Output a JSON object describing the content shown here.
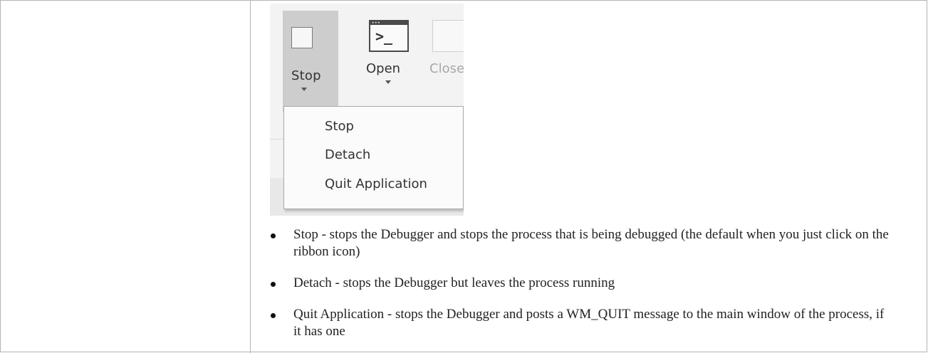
{
  "ribbon": {
    "stop_label": "Stop",
    "open_label": "Open",
    "close_label": "Close",
    "stop_icon": "stop-square-icon",
    "open_icon": "console-window-icon",
    "open_icon_prompt": ">_"
  },
  "dropdown": {
    "items": [
      "Stop",
      "Detach",
      "Quit Application"
    ]
  },
  "bullets": [
    "Stop - stops the Debugger and stops the process that is being debugged (the default when you just click on the ribbon icon)",
    "Detach - stops the Debugger but leaves the process running",
    "Quit Application - stops the Debugger and posts a WM_QUIT message to the main window of the process, if it has one"
  ]
}
